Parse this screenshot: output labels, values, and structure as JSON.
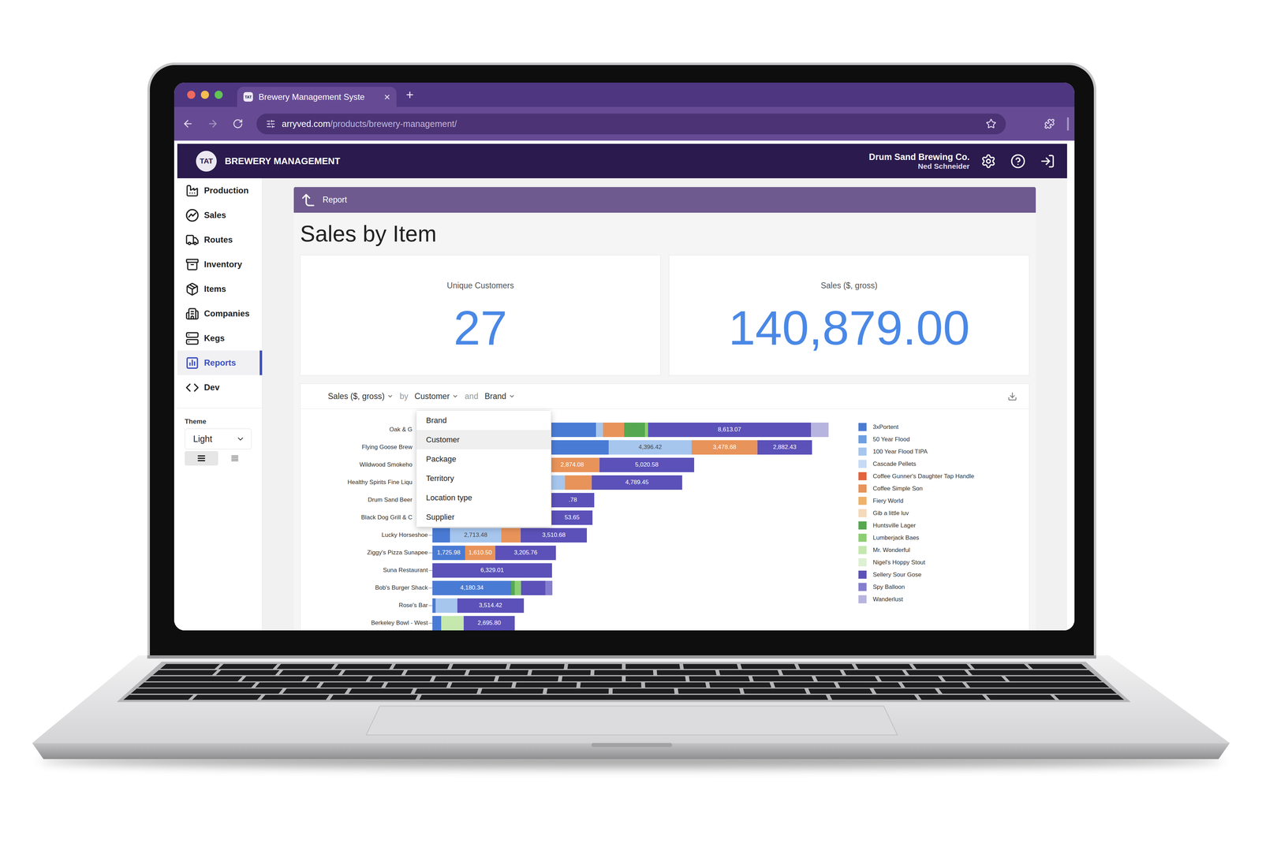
{
  "browser": {
    "window_controls": [
      {
        "color": "#ee6a5f"
      },
      {
        "color": "#f5be4f"
      },
      {
        "color": "#61c454"
      }
    ],
    "tabs": [
      {
        "favicon": "TAT",
        "title": "Brewery Management Syste",
        "close": "×",
        "selected": true
      }
    ],
    "new_tab": "+",
    "nav": {
      "back_disabled": false,
      "forward_disabled": true
    },
    "url": {
      "host": "arryved.com",
      "path": "/products/brewery-management/"
    }
  },
  "app": {
    "logo": "TAT",
    "title": "BREWERY MANAGEMENT",
    "company": "Drum Sand Brewing Co.",
    "user": "Ned Schneider"
  },
  "sidebar": {
    "items": [
      {
        "label": "Production",
        "selected": false
      },
      {
        "label": "Sales",
        "selected": false
      },
      {
        "label": "Routes",
        "selected": false
      },
      {
        "label": "Inventory",
        "selected": false
      },
      {
        "label": "Items",
        "selected": false
      },
      {
        "label": "Companies",
        "selected": false
      },
      {
        "label": "Kegs",
        "selected": false
      },
      {
        "label": "Reports",
        "selected": true
      },
      {
        "label": "Dev",
        "selected": false
      }
    ],
    "theme": {
      "label": "Theme",
      "value": "Light",
      "layouts": [
        {
          "selected": true
        },
        {
          "selected": false
        }
      ]
    }
  },
  "page": {
    "breadcrumb": "Report",
    "title": "Sales by Item"
  },
  "stats": [
    {
      "label": "Unique Customers",
      "value": "27"
    },
    {
      "label": "Sales ($, gross)",
      "value": "140,879.00"
    }
  ],
  "chart": {
    "toolbar": {
      "metric": "Sales ($, gross)",
      "by": "by",
      "group": "Customer",
      "and": "and",
      "stack": "Brand"
    },
    "group_menu": {
      "expanded": true,
      "options": [
        {
          "label": "Brand",
          "selected": false
        },
        {
          "label": "Customer",
          "selected": true
        },
        {
          "label": "Package",
          "selected": false
        },
        {
          "label": "Territory",
          "selected": false
        },
        {
          "label": "Location type",
          "selected": false
        },
        {
          "label": "Supplier",
          "selected": false
        }
      ]
    },
    "categories": [
      {
        "name": "Oak & G",
        "printed": {
          "Sellery Sour Gose": "8,613.07"
        }
      },
      {
        "name": "Flying Goose Brew",
        "printed": {
          "100 Year Flood TIPA": "4,396.42",
          "Coffee Simple Son": "3,478.68",
          "Sellery Sour Gose": "2,882.43"
        }
      },
      {
        "name": "Wildwood Smokeho",
        "printed": {
          "Coffee Simple Son": "2,874.08",
          "Sellery Sour Gose": "5,020.58"
        }
      },
      {
        "name": "Healthy Spirits Fine Liqu",
        "printed": {
          "Sellery Sour Gose": "4,789.45"
        }
      },
      {
        "name": "Drum Sand Beer",
        "printed": {
          "Sellery Sour Gose": ".78"
        }
      },
      {
        "name": "Black Dog Grill & C",
        "printed": {
          "Sellery Sour Gose": "53.65"
        }
      },
      {
        "name": "Lucky Horseshoe",
        "printed": {
          "100 Year Flood TIPA": "2,713.48",
          "Sellery Sour Gose": "3,510.68"
        }
      },
      {
        "name": "Ziggy's Pizza Sunapee",
        "printed": {
          "3xPortent": "1,725.98",
          "Coffee Simple Son": "1,610.50",
          "Sellery Sour Gose": "3,205.76"
        }
      },
      {
        "name": "Suna Restaurant",
        "printed": {
          "Sellery Sour Gose": "6,329.01"
        }
      },
      {
        "name": "Bob's Burger Shack",
        "printed": {
          "3xPortent": "4,180.34"
        }
      },
      {
        "name": "Rose's Bar",
        "printed": {
          "Sellery Sour Gose": "3,514.42"
        }
      },
      {
        "name": "Berkeley Bowl - West",
        "printed": {
          "Sellery Sour Gose": "2,695.80"
        }
      }
    ],
    "series": [
      {
        "name": "3xPortent",
        "color": "#4a7bd4",
        "values": [
          8650,
          9330,
          3408,
          5538,
          5580,
          3920,
          937,
          1725.98,
          0,
          4180.34,
          170,
          469
        ]
      },
      {
        "name": "50 Year Flood",
        "color": "#6d9fe3",
        "values": [
          0,
          0,
          1704,
          0,
          0,
          0,
          0,
          0,
          0,
          0,
          0,
          0
        ]
      },
      {
        "name": "100 Year Flood TIPA",
        "color": "#a6c6ee",
        "values": [
          383,
          4396.42,
          852,
          1491,
          0,
          0,
          2713.48,
          0,
          0,
          0,
          1150,
          0
        ]
      },
      {
        "name": "Cascade Pellets",
        "color": "#c6daf5",
        "values": [
          0,
          0,
          0,
          0,
          0,
          426,
          0,
          0,
          0,
          0,
          0,
          0
        ]
      },
      {
        "name": "Coffee Gunner's Daughter Tap Handle",
        "color": "#e4623c",
        "values": [
          0,
          0,
          0,
          0,
          724,
          0,
          0,
          0,
          0,
          0,
          0,
          0
        ]
      },
      {
        "name": "Coffee Simple Son",
        "color": "#e8935a",
        "values": [
          1108,
          3478.68,
          2874.08,
          1406,
          0,
          1960,
          1022,
          1610.5,
          0,
          0,
          0,
          0
        ]
      },
      {
        "name": "Fiery World",
        "color": "#f0b268",
        "values": [
          0,
          0,
          0,
          0,
          0,
          0,
          0,
          0,
          0,
          0,
          0,
          0
        ]
      },
      {
        "name": "Gib a little luv",
        "color": "#f5d9b8",
        "values": [
          0,
          0,
          0,
          0,
          0,
          0,
          0,
          0,
          0,
          0,
          0,
          0
        ]
      },
      {
        "name": "Huntsville Lager",
        "color": "#55a84f",
        "values": [
          1108,
          0,
          0,
          0,
          0,
          0,
          0,
          0,
          0,
          170,
          0,
          0
        ]
      },
      {
        "name": "Lumberjack Baes",
        "color": "#8ccf73",
        "values": [
          170,
          0,
          0,
          0,
          0,
          0,
          0,
          0,
          0,
          341,
          0,
          0
        ]
      },
      {
        "name": "Mr. Wonderful",
        "color": "#c4e8ae",
        "values": [
          0,
          0,
          0,
          0,
          0,
          0,
          0,
          0,
          0,
          0,
          0,
          1193
        ]
      },
      {
        "name": "Nigel's Hoppy Stout",
        "color": "#dcf0d2",
        "values": [
          0,
          0,
          0,
          0,
          0,
          0,
          0,
          0,
          0,
          0,
          0,
          0
        ]
      },
      {
        "name": "Sellery Sour Gose",
        "color": "#5b51b8",
        "values": [
          8613.07,
          2882.43,
          5020.58,
          4789.45,
          2258.78,
          2172.65,
          3510.68,
          3205.76,
          6329.01,
          1278,
          3514.42,
          2695.8
        ]
      },
      {
        "name": "Spy Balloon",
        "color": "#857ed0",
        "values": [
          0,
          0,
          0,
          0,
          0,
          0,
          0,
          0,
          0,
          383,
          0,
          0
        ]
      },
      {
        "name": "Wanderlust",
        "color": "#b8b4e0",
        "values": [
          937,
          0,
          0,
          0,
          0,
          0,
          0,
          0,
          0,
          0,
          0,
          0
        ]
      }
    ]
  }
}
